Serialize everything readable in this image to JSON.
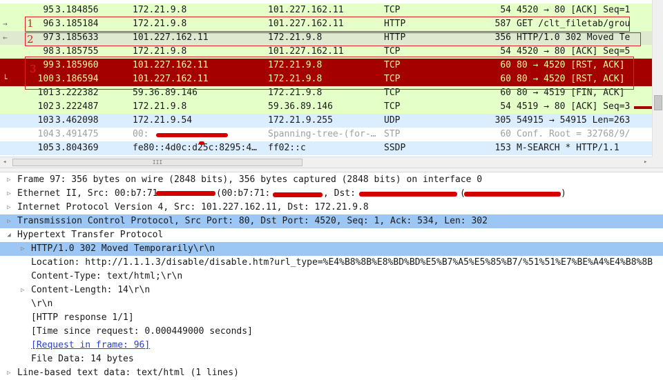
{
  "packets": [
    {
      "no": "95",
      "time": "3.184856",
      "src": "172.21.9.8",
      "dst": "101.227.162.11",
      "proto": "TCP",
      "len": "54",
      "info": "4520 → 80 [ACK] Seq=1"
    },
    {
      "no": "96",
      "time": "3.185184",
      "src": "172.21.9.8",
      "dst": "101.227.162.11",
      "proto": "HTTP",
      "len": "587",
      "info": "GET /clt_filetab/grou"
    },
    {
      "no": "97",
      "time": "3.185633",
      "src": "101.227.162.11",
      "dst": "172.21.9.8",
      "proto": "HTTP",
      "len": "356",
      "info": "HTTP/1.0 302 Moved Te"
    },
    {
      "no": "98",
      "time": "3.185755",
      "src": "172.21.9.8",
      "dst": "101.227.162.11",
      "proto": "TCP",
      "len": "54",
      "info": "4520 → 80 [ACK] Seq=5"
    },
    {
      "no": "99",
      "time": "3.185960",
      "src": "101.227.162.11",
      "dst": "172.21.9.8",
      "proto": "TCP",
      "len": "60",
      "info": "80 → 4520 [RST, ACK]"
    },
    {
      "no": "100",
      "time": "3.186594",
      "src": "101.227.162.11",
      "dst": "172.21.9.8",
      "proto": "TCP",
      "len": "60",
      "info": "80 → 4520 [RST, ACK]"
    },
    {
      "no": "101",
      "time": "3.222382",
      "src": "59.36.89.146",
      "dst": "172.21.9.8",
      "proto": "TCP",
      "len": "60",
      "info": "80 → 4519 [FIN, ACK]"
    },
    {
      "no": "102",
      "time": "3.222487",
      "src": "172.21.9.8",
      "dst": "59.36.89.146",
      "proto": "TCP",
      "len": "54",
      "info": "4519 → 80 [ACK] Seq=3"
    },
    {
      "no": "103",
      "time": "3.462098",
      "src": "172.21.9.54",
      "dst": "172.21.9.255",
      "proto": "UDP",
      "len": "305",
      "info": "54915 → 54915 Len=263"
    },
    {
      "no": "104",
      "time": "3.491475",
      "src": "00:",
      "": "",
      "dst": "Spanning-tree-(for-…",
      "proto": "STP",
      "len": "60",
      "info": "Conf. Root = 32768/9/"
    },
    {
      "no": "105",
      "time": "3.804369",
      "src": "fe80::4d0c:d25c:8295:4…",
      "dst": "ff02::c",
      "proto": "SSDP",
      "len": "153",
      "info": "M-SEARCH * HTTP/1.1"
    }
  ],
  "annotations": {
    "a1": "1",
    "a2": "2",
    "a3": "3"
  },
  "scroll": {
    "hthumb_label": "III"
  },
  "details": {
    "frame": "Frame 97: 356 bytes on wire (2848 bits), 356 bytes captured (2848 bits) on interface 0",
    "eth_a": "Ethernet II, Src: 00:b7:71:",
    "eth_b": "(00:b7:71:",
    "eth_c": ", Dst:",
    "eth_d": "(",
    "eth_e": ")",
    "ip": "Internet Protocol Version 4, Src: 101.227.162.11, Dst: 172.21.9.8",
    "tcp": "Transmission Control Protocol, Src Port: 80, Dst Port: 4520, Seq: 1, Ack: 534, Len: 302",
    "http": "Hypertext Transfer Protocol",
    "status": "HTTP/1.0 302 Moved Temporarily\\r\\n",
    "location": "Location: http://1.1.1.3/disable/disable.htm?url_type=%E4%B8%8B%E8%BD%BD%E5%B7%A5%E5%85%B7/%51%51%E7%BE%A4%E4%B8%8B",
    "ctype": "Content-Type: text/html;\\r\\n",
    "clen": "Content-Length: 14\\r\\n",
    "crlf": "\\r\\n",
    "resp": "[HTTP response 1/1]",
    "time": "[Time since request: 0.000449000 seconds]",
    "req": "[Request in frame: 96]",
    "filedata": "File Data: 14 bytes",
    "linebased": "Line-based text data: text/html (1 lines)"
  }
}
